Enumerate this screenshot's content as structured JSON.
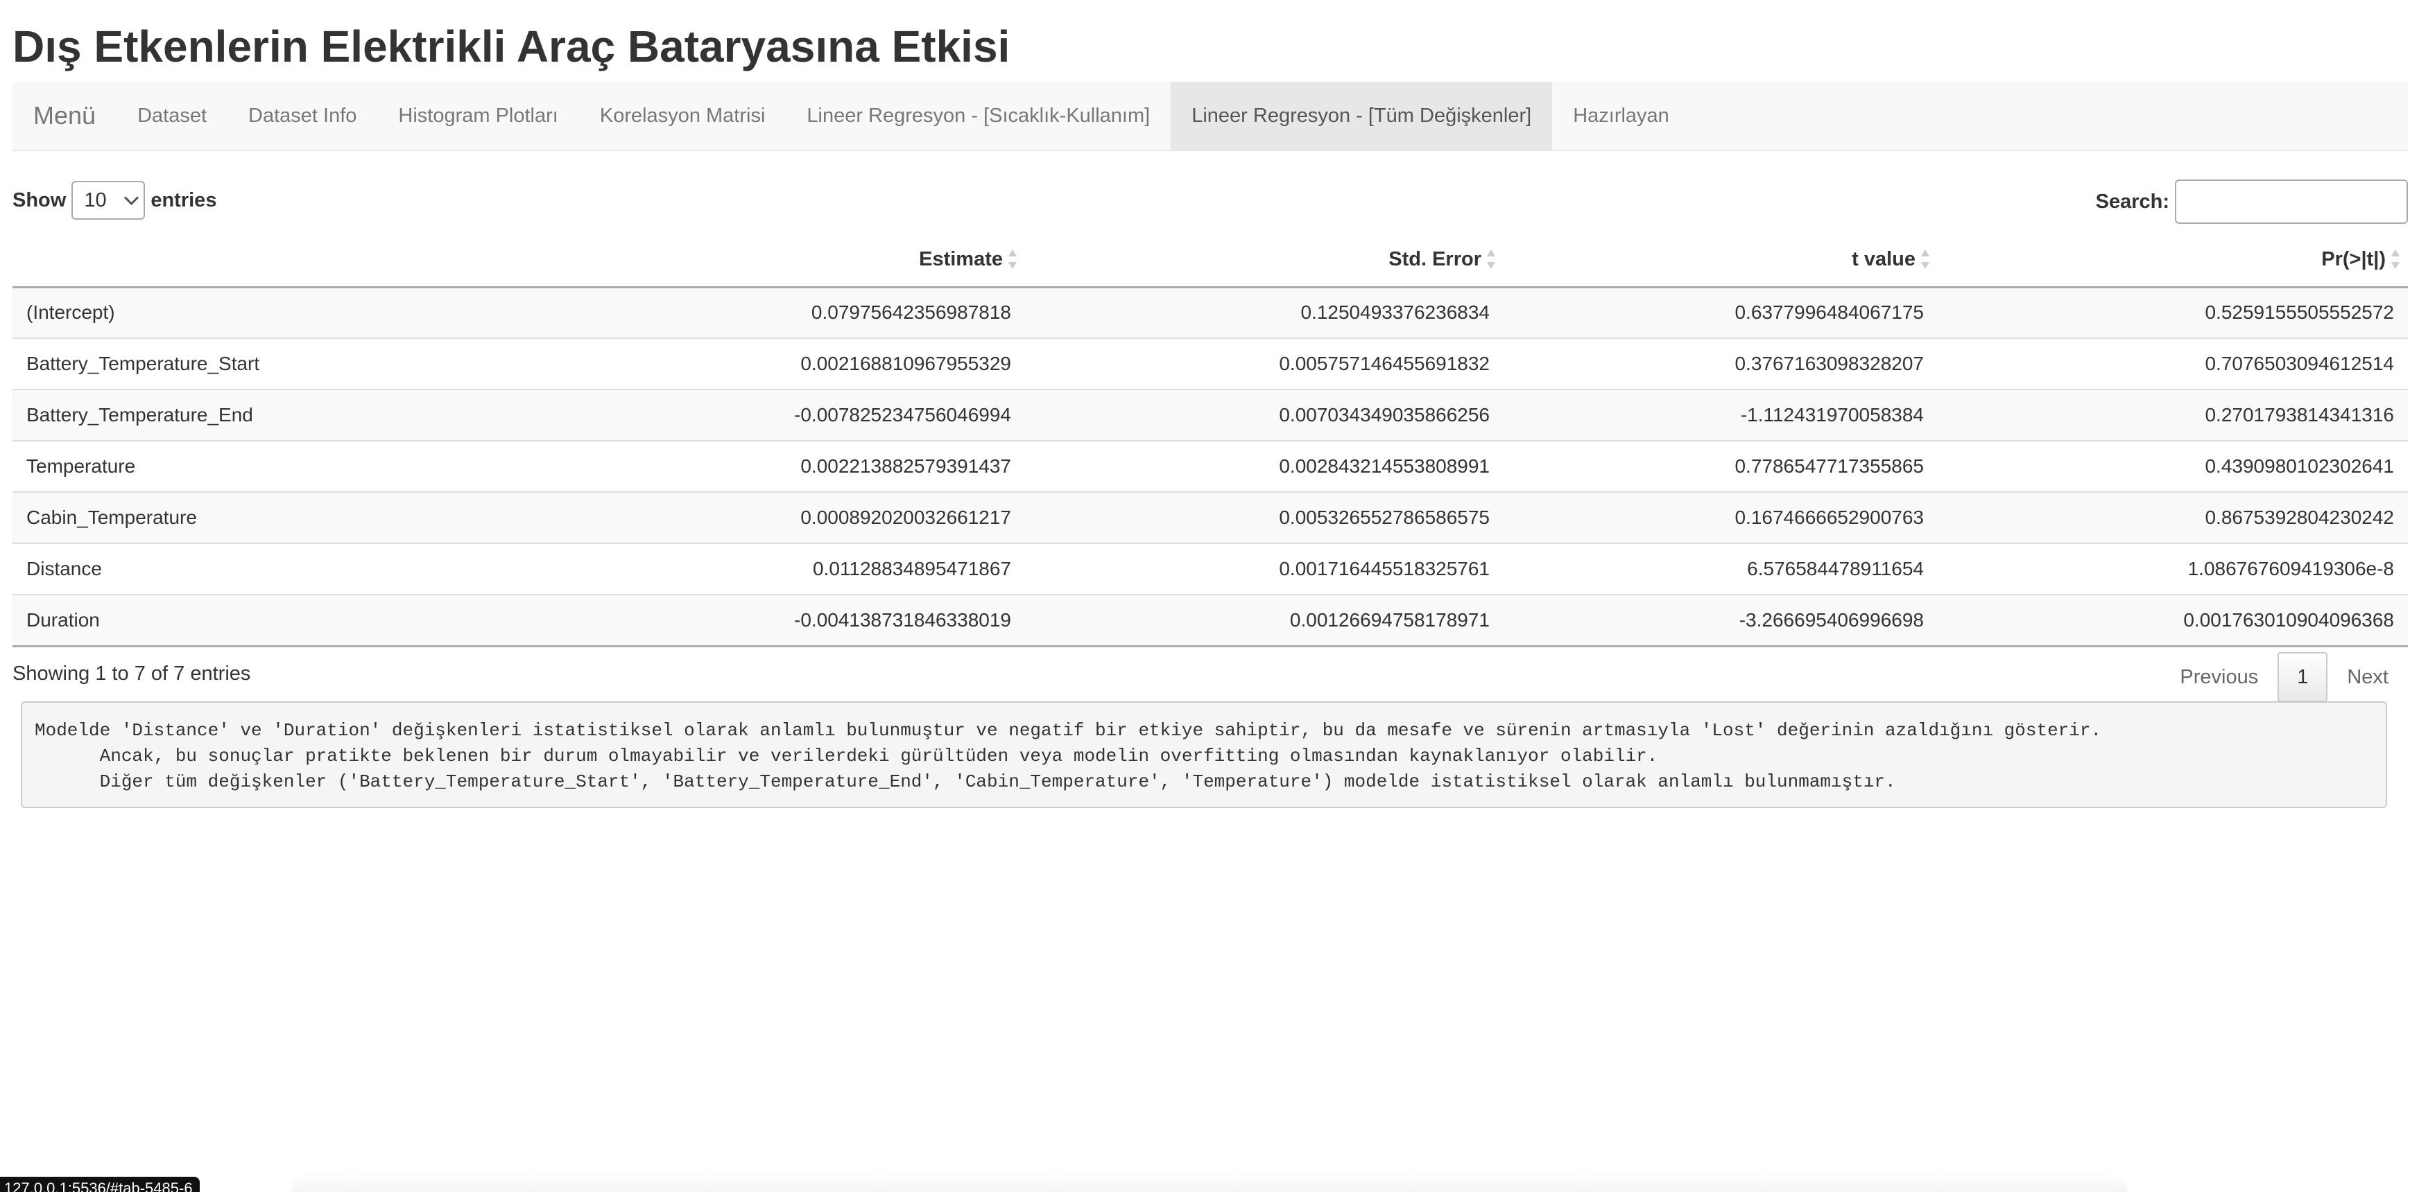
{
  "page_title": "Dış Etkenlerin Elektrikli Araç Bataryasına Etkisi",
  "navbar": {
    "brand": "Menü",
    "tabs": [
      {
        "label": "Dataset",
        "active": false
      },
      {
        "label": "Dataset Info",
        "active": false
      },
      {
        "label": "Histogram Plotları",
        "active": false
      },
      {
        "label": "Korelasyon Matrisi",
        "active": false
      },
      {
        "label": "Lineer Regresyon - [Sıcaklık-Kullanım]",
        "active": false
      },
      {
        "label": "Lineer Regresyon - [Tüm Değişkenler]",
        "active": true
      },
      {
        "label": "Hazırlayan",
        "active": false
      }
    ]
  },
  "length": {
    "show_label": "Show",
    "value": "10",
    "entries_label": "entries"
  },
  "search": {
    "label": "Search:",
    "value": ""
  },
  "table": {
    "columns": [
      "",
      "Estimate",
      "Std. Error",
      "t value",
      "Pr(>|t|)"
    ],
    "rows": [
      [
        "(Intercept)",
        "0.07975642356987818",
        "0.1250493376236834",
        "0.6377996484067175",
        "0.5259155505552572"
      ],
      [
        "Battery_Temperature_Start",
        "0.002168810967955329",
        "0.005757146455691832",
        "0.3767163098328207",
        "0.7076503094612514"
      ],
      [
        "Battery_Temperature_End",
        "-0.007825234756046994",
        "0.007034349035866256",
        "-1.112431970058384",
        "0.2701793814341316"
      ],
      [
        "Temperature",
        "0.002213882579391437",
        "0.002843214553808991",
        "0.7786547717355865",
        "0.4390980102302641"
      ],
      [
        "Cabin_Temperature",
        "0.000892020032661217",
        "0.005326552786586575",
        "0.1674666652900763",
        "0.8675392804230242"
      ],
      [
        "Distance",
        "0.01128834895471867",
        "0.001716445518325761",
        "6.576584478911654",
        "1.086767609419306e-8"
      ],
      [
        "Duration",
        "-0.004138731846338019",
        "0.00126694758178971",
        "-3.266695406996698",
        "0.001763010904096368"
      ]
    ]
  },
  "info_text": "Showing 1 to 7 of 7 entries",
  "pagination": {
    "previous": "Previous",
    "current": "1",
    "next": "Next"
  },
  "note_text": "Modelde 'Distance' ve 'Duration' değişkenleri istatistiksel olarak anlamlı bulunmuştur ve negatif bir etkiye sahiptir, bu da mesafe ve sürenin artmasıyla 'Lost' değerinin azaldığını gösterir.\n      Ancak, bu sonuçlar pratikte beklenen bir durum olmayabilir ve verilerdeki gürültüden veya modelin overfitting olmasından kaynaklanıyor olabilir.\n      Diğer tüm değişkenler ('Battery_Temperature_Start', 'Battery_Temperature_End', 'Cabin_Temperature', 'Temperature') modelde istatistiksel olarak anlamlı bulunmamıştır.",
  "status_url": "127.0.0.1:5536/#tab-5485-6"
}
